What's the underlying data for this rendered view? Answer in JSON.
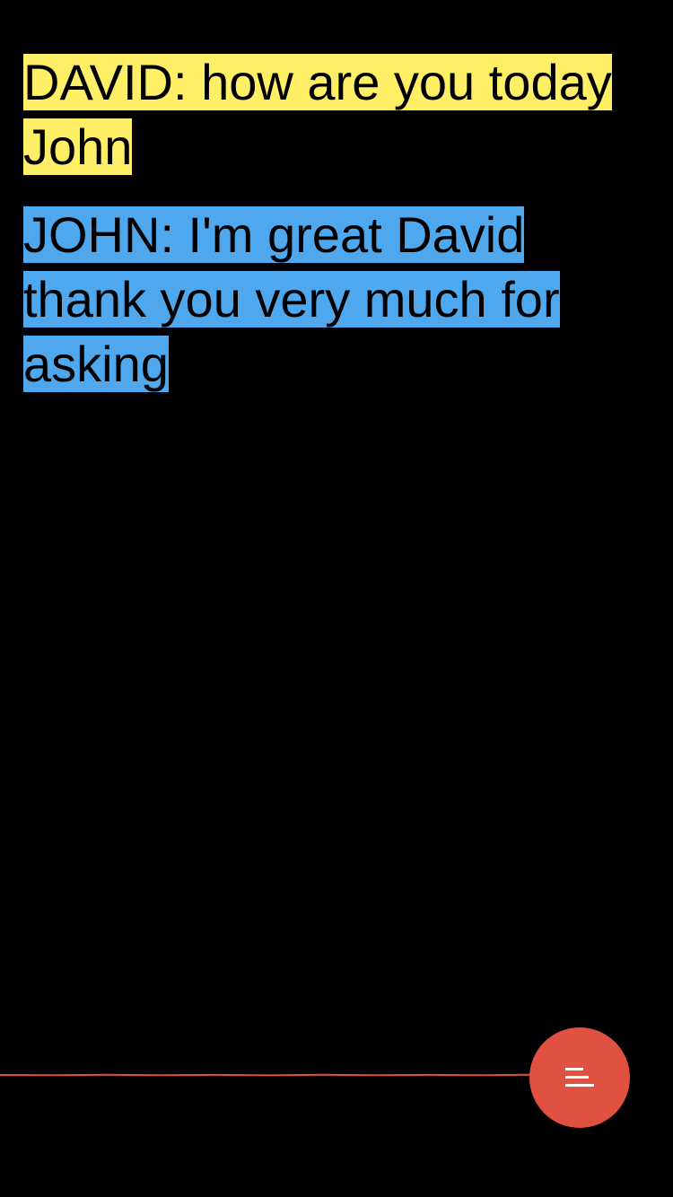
{
  "transcript": {
    "lines": [
      {
        "speaker": "DAVID",
        "text": "DAVID: how are you today John",
        "color": "#FEEF66"
      },
      {
        "speaker": "JOHN",
        "text": "JOHN: I'm great David thank you very much for asking",
        "color": "#4FA8EE"
      }
    ]
  },
  "audio_level": {
    "line_color": "#E15141"
  },
  "fab": {
    "icon": "menu-lines-icon",
    "color": "#E15141"
  },
  "colors": {
    "background": "#000000"
  }
}
